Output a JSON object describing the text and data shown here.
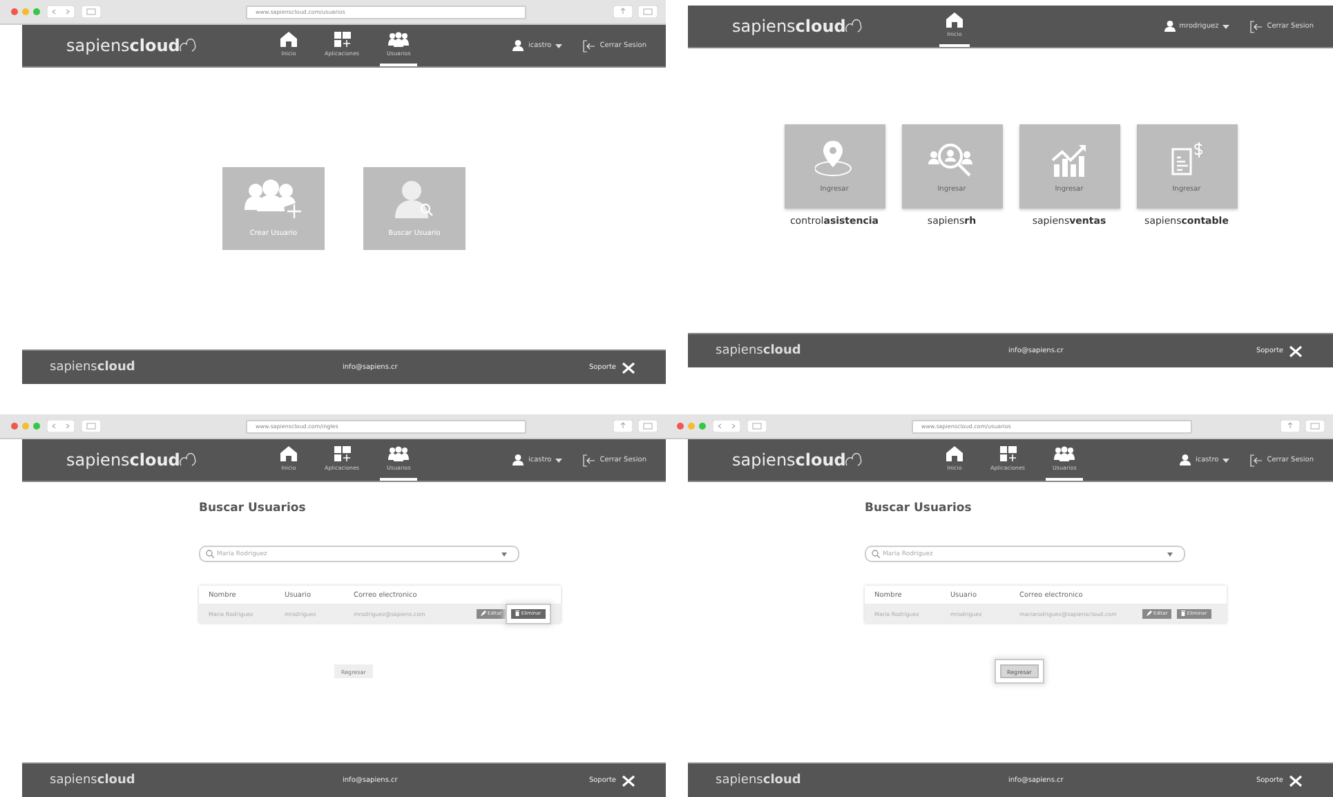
{
  "screens": [
    {
      "browser": {
        "url": "www.sapienscloud.com/usuarios"
      },
      "logo": "sapiens**cloud**",
      "nav": [
        {
          "label": "Inicio",
          "selected": false
        },
        {
          "label": "Aplicaciones",
          "selected": false
        },
        {
          "label": "Usuarios",
          "selected": true
        }
      ],
      "user": "icastro",
      "logout": "Cerrar Sesion",
      "content": {
        "kind": "tiles",
        "tiles": [
          {
            "label": "Crear Usuario"
          },
          {
            "label": "Buscar Usuario"
          }
        ]
      },
      "footer": {
        "logo": "sapiens**cloud**",
        "email": "info@sapiens.cr",
        "support": "Soporte"
      }
    },
    {
      "logo": "sapiens**cloud**",
      "nav": [
        {
          "label": "Inicio",
          "selected": true
        }
      ],
      "user": "mrodriguez",
      "logout": "Cerrar Sesion",
      "content": {
        "kind": "apps",
        "apps": [
          {
            "action": "Ingresar",
            "name": "control**asistencia**"
          },
          {
            "action": "Ingresar",
            "name": "sapiens**rh**"
          },
          {
            "action": "Ingresar",
            "name": "sapiens**ventas**"
          },
          {
            "action": "Ingresar",
            "name": "sapiens**contable**"
          }
        ]
      },
      "footer": {
        "logo": "sapiens**cloud**",
        "email": "info@sapiens.cr",
        "support": "Soporte"
      }
    },
    {
      "browser": {
        "url": "www.sapienscloud.com/ingles"
      },
      "logo": "sapiens**cloud**",
      "nav": [
        {
          "label": "Inicio",
          "selected": false
        },
        {
          "label": "Aplicaciones",
          "selected": false
        },
        {
          "label": "Usuarios",
          "selected": true
        }
      ],
      "user": "icastro",
      "logout": "Cerrar Sesion",
      "content": {
        "kind": "search",
        "title": "Buscar Usuarios",
        "search": "Maria Rodriguez",
        "columns": [
          "Nombre",
          "Usuario",
          "Correo electronico"
        ],
        "rows": [
          {
            "cells": [
              "Maria Rodriguez",
              "mrodriguez",
              "mrodriguez@sapiens.com"
            ],
            "buttons": [
              {
                "label": "Editar",
                "touched": false
              },
              {
                "label": "Eliminar",
                "touched": true
              }
            ]
          }
        ],
        "back": {
          "label": "Regresar",
          "touched": false
        }
      },
      "footer": {
        "logo": "sapiens**cloud**",
        "email": "info@sapiens.cr",
        "support": "Soporte"
      }
    },
    {
      "browser": {
        "url": "www.sapienscloud.com/usuarios"
      },
      "logo": "sapiens**cloud**",
      "nav": [
        {
          "label": "Inicio",
          "selected": false
        },
        {
          "label": "Aplicaciones",
          "selected": false
        },
        {
          "label": "Usuarios",
          "selected": true
        }
      ],
      "user": "icastro",
      "logout": "Cerrar Sesion",
      "content": {
        "kind": "search",
        "title": "Buscar Usuarios",
        "search": "Maria Rodriguez",
        "columns": [
          "Nombre",
          "Usuario",
          "Correo electronico"
        ],
        "rows": [
          {
            "cells": [
              "Maria Rodriguez",
              "mrodriguez",
              "mariarodriguez@sapienscloud.com"
            ],
            "buttons": [
              {
                "label": "Editar",
                "touched": false
              },
              {
                "label": "Eliminar",
                "touched": false
              }
            ]
          }
        ],
        "back": {
          "label": "Regresar",
          "touched": true
        }
      },
      "footer": {
        "logo": "sapiens**cloud**",
        "email": "info@sapiens.cr",
        "support": "Soporte"
      }
    }
  ]
}
